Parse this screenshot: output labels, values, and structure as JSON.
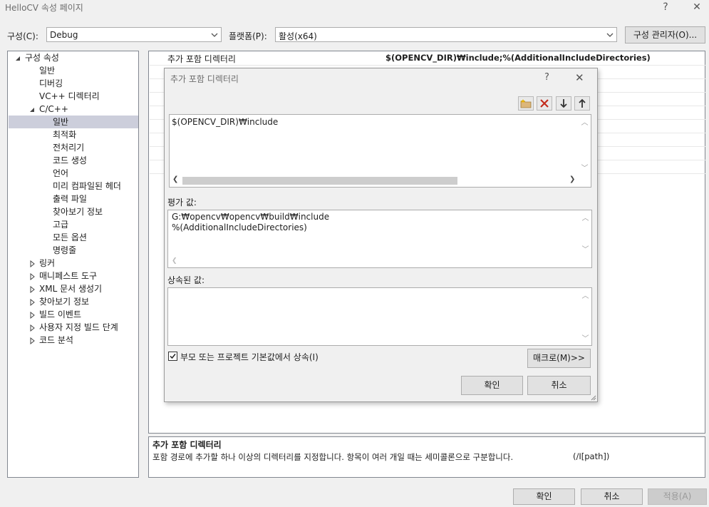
{
  "window": {
    "title": "HelloCV 속성 페이지",
    "help_label": "?",
    "close_label": "✕"
  },
  "config": {
    "label": "구성(C):",
    "value": "Debug",
    "platform_label": "플랫폼(P):",
    "platform_value": "활성(x64)",
    "manager_button": "구성 관리자(O)..."
  },
  "tree": {
    "root": "구성 속성",
    "items_top": [
      "일반",
      "디버깅",
      "VC++ 디렉터리"
    ],
    "cpp": "C/C++",
    "cpp_children": [
      "일반",
      "최적화",
      "전처리기",
      "코드 생성",
      "언어",
      "미리 컴파일된 헤더",
      "출력 파일",
      "찾아보기 정보",
      "고급",
      "모든 옵션",
      "명령줄"
    ],
    "collapsed": [
      "링커",
      "매니페스트 도구",
      "XML 문서 생성기",
      "찾아보기 정보",
      "빌드 이벤트",
      "사용자 지정 빌드 단계",
      "코드 분석"
    ]
  },
  "grid": {
    "property_name": "추가 포함 디렉터리",
    "property_value": "$(OPENCV_DIR)₩include;%(AdditionalIncludeDirectories)"
  },
  "description": {
    "title": "추가 포함 디렉터리",
    "text": "포함 경로에 추가할 하나 이상의 디렉터리를 지정합니다. 항목이 여러 개일 때는 세미콜론으로 구분합니다.",
    "switch": "(/I[path])"
  },
  "dialog": {
    "title": "추가 포함 디렉터리",
    "help_label": "?",
    "close_label": "✕",
    "entry": "$(OPENCV_DIR)₩include",
    "evaluated_label": "평가 값:",
    "evaluated_lines": [
      "G:₩opencv₩opencv₩build₩include",
      "%(AdditionalIncludeDirectories)"
    ],
    "inherited_label": "상속된 값:",
    "inherit_checkbox_label": "부모 또는 프로젝트 기본값에서 상속(I)",
    "inherit_checked": true,
    "macro_button": "매크로(M)>>",
    "ok_button": "확인",
    "cancel_button": "취소",
    "toolbar_icons": [
      "new-folder-icon",
      "delete-icon",
      "move-down-icon",
      "move-up-icon"
    ]
  },
  "footer": {
    "ok_button": "확인",
    "cancel_button": "취소",
    "apply_button": "적용(A)"
  },
  "colors": {
    "selection": "#cccedb",
    "border": "#828790",
    "delete_red": "#c42b1c",
    "folder_yellow": "#dcb67a"
  }
}
